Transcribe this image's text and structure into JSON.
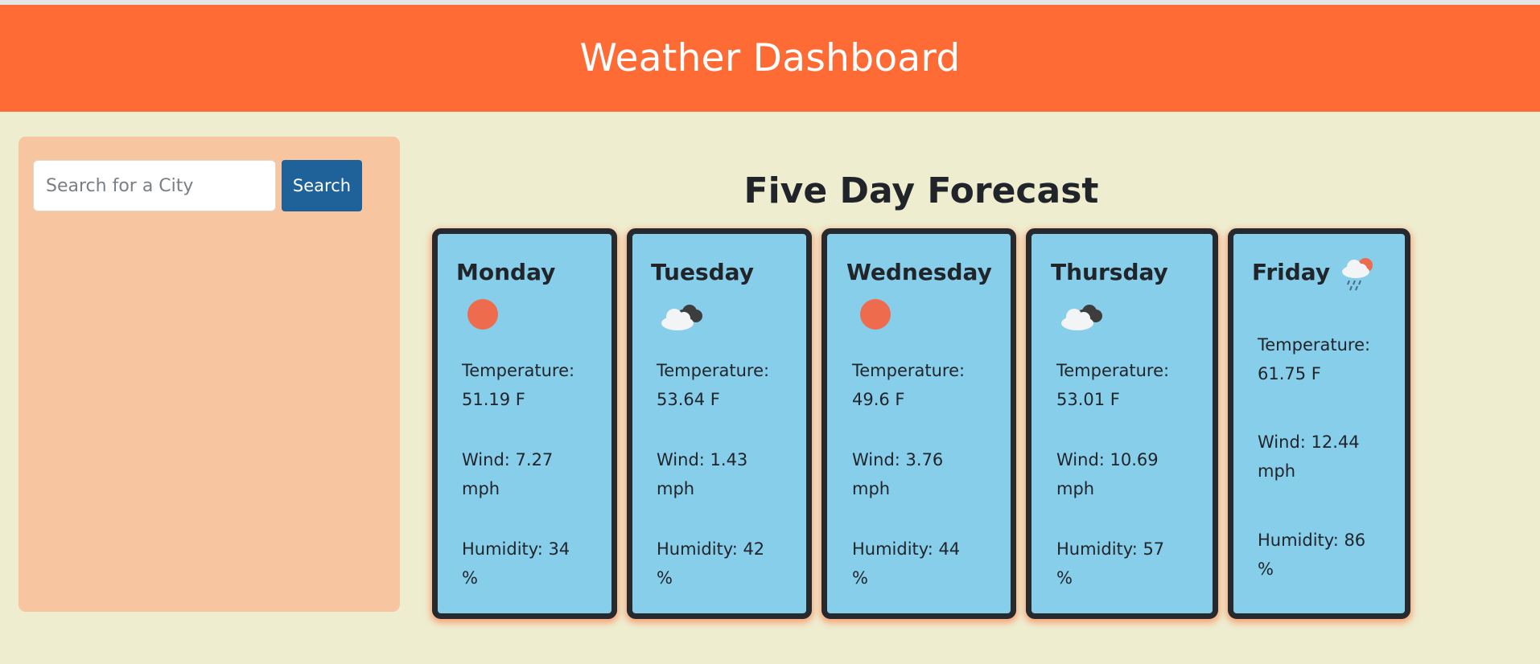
{
  "header": {
    "title": "Weather Dashboard"
  },
  "search": {
    "placeholder": "Search for a City",
    "button_label": "Search"
  },
  "forecast": {
    "title": "Five Day Forecast",
    "days": [
      {
        "day": "Monday",
        "icon": "sun-icon",
        "temperature_line": "Temperature:",
        "temperature_value": "51.19 F",
        "wind_line": "Wind: 7.27",
        "wind_unit": "mph",
        "humidity_line": "Humidity: 34",
        "humidity_unit": "%"
      },
      {
        "day": "Tuesday",
        "icon": "cloudy-icon",
        "temperature_line": "Temperature:",
        "temperature_value": "53.64 F",
        "wind_line": "Wind: 1.43",
        "wind_unit": "mph",
        "humidity_line": "Humidity: 42",
        "humidity_unit": "%"
      },
      {
        "day": "Wednesday",
        "icon": "sun-icon",
        "temperature_line": "Temperature:",
        "temperature_value": "49.6 F",
        "wind_line": "Wind: 3.76",
        "wind_unit": "mph",
        "humidity_line": "Humidity: 44",
        "humidity_unit": "%"
      },
      {
        "day": "Thursday",
        "icon": "cloudy-icon",
        "temperature_line": "Temperature:",
        "temperature_value": "53.01 F",
        "wind_line": "Wind: 10.69",
        "wind_unit": "mph",
        "humidity_line": "Humidity: 57",
        "humidity_unit": "%"
      },
      {
        "day": "Friday",
        "icon": "rain-icon",
        "temperature_line": "Temperature:",
        "temperature_value": "61.75 F",
        "wind_line": "Wind: 12.44",
        "wind_unit": "mph",
        "humidity_line": "Humidity: 86",
        "humidity_unit": "%"
      }
    ]
  },
  "colors": {
    "header_bg": "#ff6b35",
    "page_bg": "#eeedd0",
    "sidebar_bg": "#f7c59f",
    "search_button_bg": "#1f6199",
    "card_bg": "#87ceeb",
    "card_border": "#262a2e",
    "sun": "#ee6c4d"
  }
}
